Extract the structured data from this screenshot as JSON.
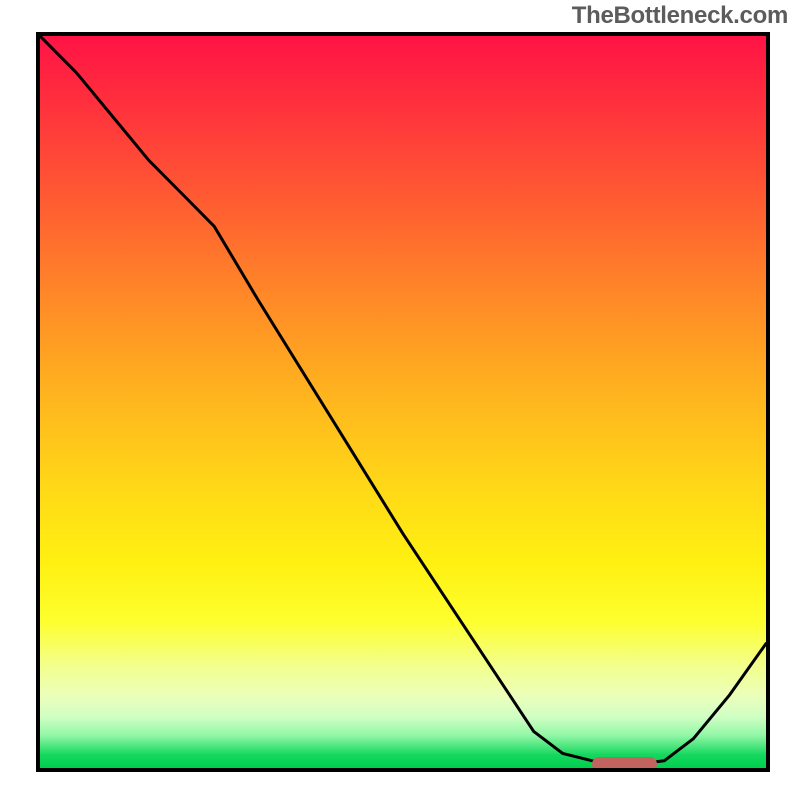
{
  "watermark": "TheBottleneck.com",
  "chart_data": {
    "type": "line",
    "title": "",
    "xlabel": "",
    "ylabel": "",
    "x": [
      0.0,
      0.05,
      0.1,
      0.15,
      0.2,
      0.24,
      0.3,
      0.4,
      0.5,
      0.6,
      0.68,
      0.72,
      0.76,
      0.79,
      0.82,
      0.86,
      0.9,
      0.95,
      1.0
    ],
    "values": [
      1.0,
      0.95,
      0.89,
      0.83,
      0.78,
      0.74,
      0.64,
      0.48,
      0.32,
      0.17,
      0.05,
      0.02,
      0.01,
      0.005,
      0.005,
      0.01,
      0.04,
      0.1,
      0.17
    ],
    "xlim": [
      0,
      1
    ],
    "ylim": [
      0,
      1
    ],
    "marker_band": {
      "x_start": 0.76,
      "x_end": 0.85,
      "y": 0.005
    }
  },
  "colors": {
    "curve": "#000000",
    "pill": "#c1635f",
    "gradient_top": "#ff1345",
    "gradient_mid": "#ffd917",
    "gradient_bottom": "#00cf4f"
  }
}
